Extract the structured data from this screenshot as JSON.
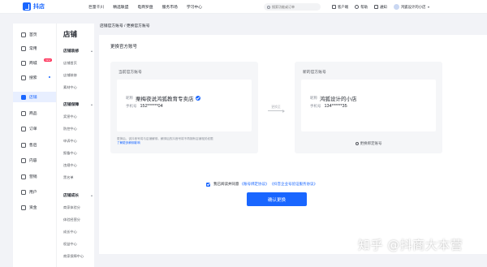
{
  "topbar": {
    "logo_text": "抖店",
    "nav": [
      "巨量千川",
      "精选联盟",
      "电商罗盘",
      "服务市场",
      "学习中心"
    ],
    "search_placeholder": "搜索功能或订单",
    "right": {
      "service": "客户端",
      "help": "帮助",
      "notify": "通知",
      "user": "鸿狐设计的小店"
    }
  },
  "sidebar": {
    "items": [
      {
        "label": "首页",
        "icon": "home-icon"
      },
      {
        "label": "常用",
        "icon": "bookmark-icon"
      },
      {
        "label": "商城",
        "icon": "shop-icon",
        "badge": "NEW"
      },
      {
        "label": "搜索",
        "icon": "search-icon"
      },
      {
        "label": "店铺",
        "icon": "store-icon",
        "active": true
      },
      {
        "label": "商品",
        "icon": "box-icon"
      },
      {
        "label": "订单",
        "icon": "order-icon"
      },
      {
        "label": "售后",
        "icon": "aftersale-icon"
      },
      {
        "label": "内容",
        "icon": "content-icon"
      },
      {
        "label": "营销",
        "icon": "marketing-icon"
      },
      {
        "label": "用户",
        "icon": "user-icon"
      },
      {
        "label": "资金",
        "icon": "money-icon"
      }
    ]
  },
  "subnav": {
    "title": "店铺",
    "groups": [
      {
        "label": "店铺装修",
        "items": [
          "店铺首页",
          "店铺装修",
          "素材中心"
        ]
      },
      {
        "label": "店铺保障",
        "items": [
          "奖惩中心",
          "防控中心",
          "申诉中心",
          "报备中心",
          "违规中心",
          "黑名单"
        ]
      },
      {
        "label": "店铺成长",
        "items": [
          "商家体验分",
          "体验经营分",
          "成长中心",
          "权益中心",
          "商家保障中心"
        ]
      }
    ]
  },
  "breadcrumb": "店铺官方账号 / 更换官方账号",
  "panel": {
    "title": "更换官方账号",
    "current": {
      "label": "当前官方账号",
      "nickname_label": "昵称",
      "nickname": "栗梅夜说鸿狐教育专卖店",
      "phone_label": "手机号",
      "phone": "152******04",
      "note": "更换后，该抖音号将与店铺解绑，解绑后的抖音号将不再拥有店铺相关权限",
      "note_link": "了解更多解绑影响"
    },
    "arrow_label": "更换至",
    "new": {
      "label": "新的官方账号",
      "nickname_label": "昵称",
      "nickname": "鸿狐设计的小店",
      "phone_label": "手机号",
      "phone": "134******35",
      "change_link": "更换绑定账号"
    },
    "agree_text": "我已阅读并同意",
    "agree_link1": "《账号绑定协议》",
    "agree_link2": "《抖音企业号验证服务协议》",
    "confirm_label": "确认更换"
  },
  "watermark": "知乎 @抖商大本营"
}
